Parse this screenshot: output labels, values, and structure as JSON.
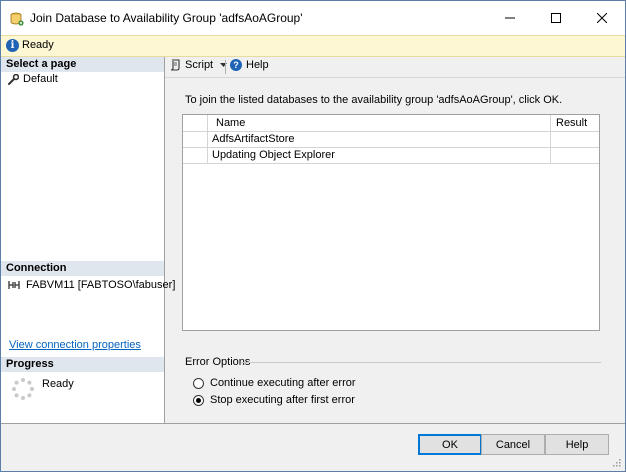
{
  "window": {
    "title": "Join Database to Availability Group 'adfsAoAGroup'"
  },
  "status": {
    "text": "Ready"
  },
  "left": {
    "select_page_header": "Select a page",
    "pages": [
      {
        "label": "Default"
      }
    ],
    "connection_header": "Connection",
    "connection_text": "FABVM11 [FABTOSO\\fabuser]",
    "view_connection_link": "View connection properties",
    "progress_header": "Progress",
    "progress_status": "Ready"
  },
  "toolbar": {
    "script_label": "Script",
    "help_label": "Help"
  },
  "main": {
    "instruction": "To join the listed databases to the availability group 'adfsAoAGroup', click OK.",
    "grid": {
      "columns": [
        "Name",
        "Result"
      ],
      "rows": [
        {
          "name": "AdfsArtifactStore",
          "result": ""
        },
        {
          "name": "Updating Object Explorer",
          "result": ""
        }
      ]
    },
    "error_options": {
      "label": "Error Options",
      "options": [
        {
          "label": "Continue executing after error",
          "checked": false
        },
        {
          "label": "Stop executing after first error",
          "checked": true
        }
      ]
    }
  },
  "buttons": {
    "ok": "OK",
    "cancel": "Cancel",
    "help": "Help"
  },
  "colors": {
    "accent": "#0078d7",
    "status_bar": "#fdf7d3",
    "section_header": "#dfe6ee",
    "link": "#0563c1"
  }
}
